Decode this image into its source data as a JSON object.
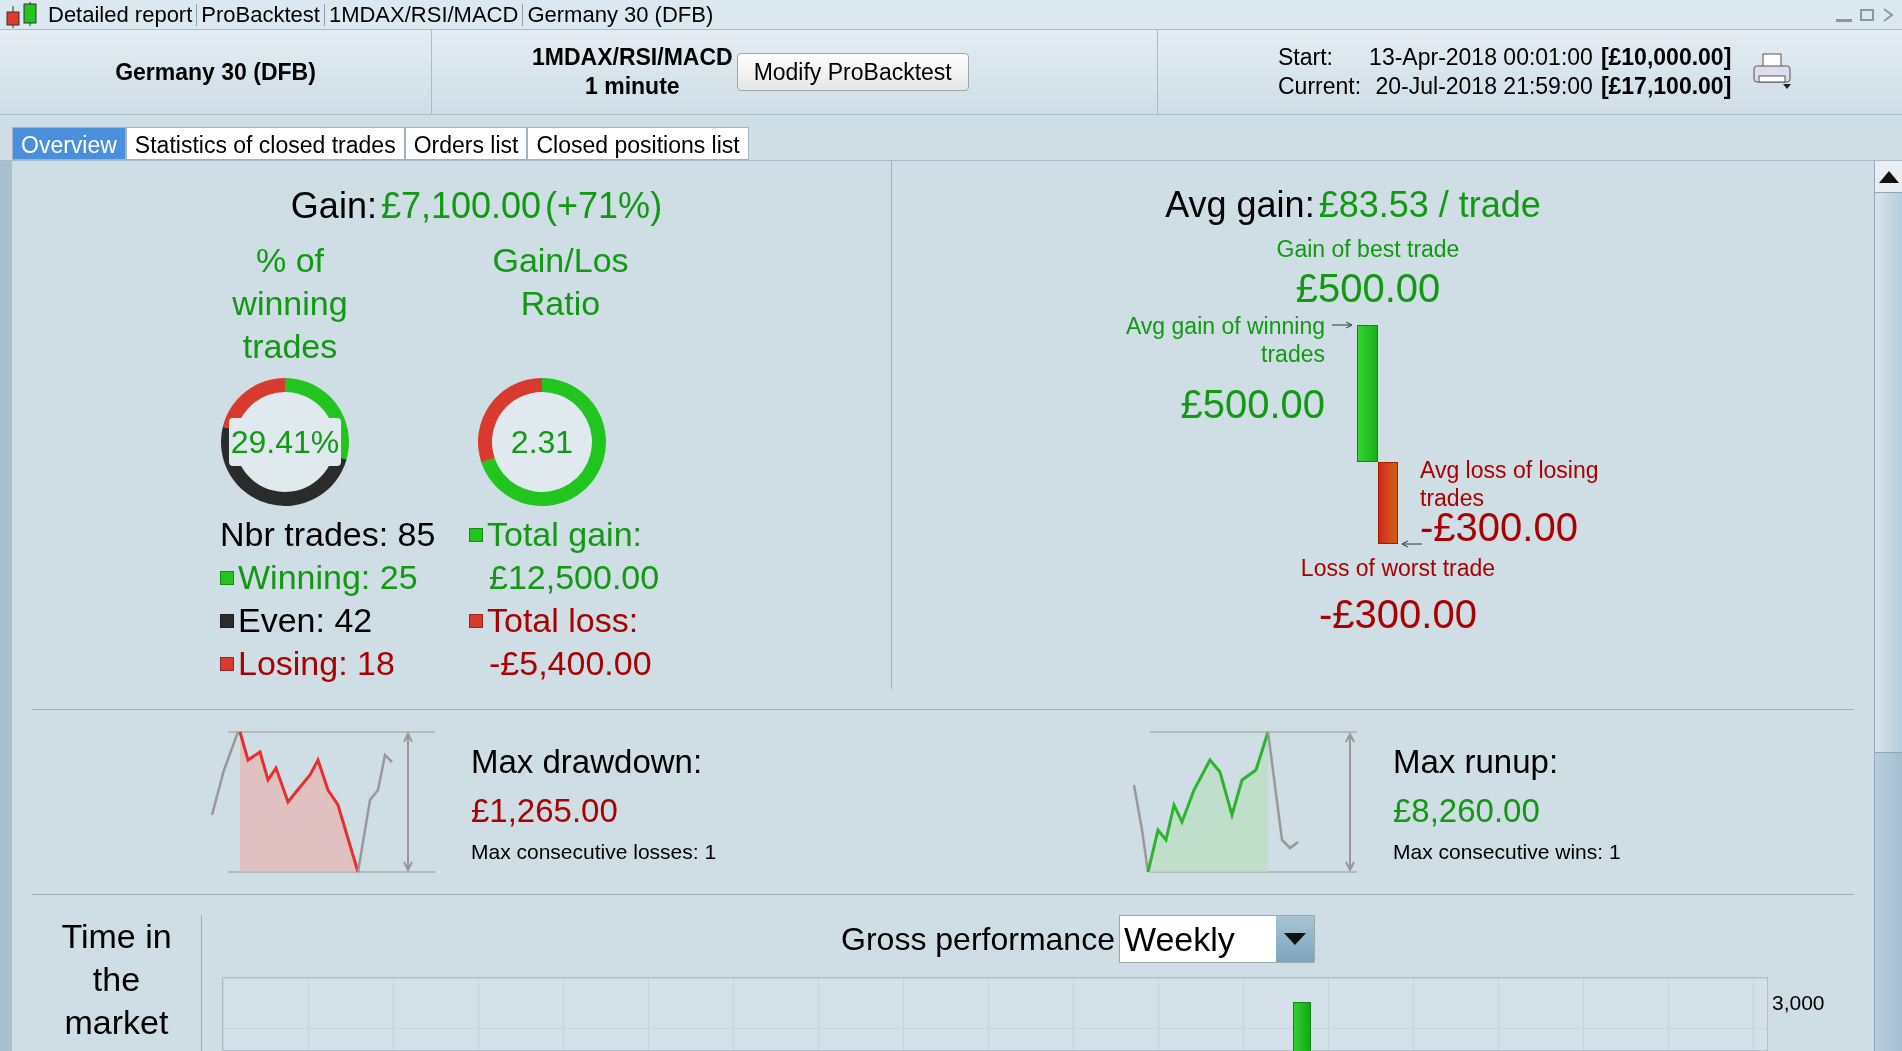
{
  "title_bar": {
    "items": [
      "Detailed report",
      "ProBacktest",
      "1MDAX/RSI/MACD",
      "Germany 30 (DFB)"
    ]
  },
  "header": {
    "instrument": "Germany 30 (DFB)",
    "system": "1MDAX/RSI/MACD",
    "timeframe": "1 minute",
    "modify_button": "Modify ProBacktest",
    "start_label": "Start:",
    "start_date": "13-Apr-2018 00:01:00",
    "start_capital": "[£10,000.00]",
    "current_label": "Current:",
    "current_date": "20-Jul-2018 21:59:00",
    "current_capital": "[£17,100.00]"
  },
  "tabs": [
    {
      "label": "Overview",
      "selected": true
    },
    {
      "label": "Statistics of closed trades",
      "selected": false
    },
    {
      "label": "Orders list",
      "selected": false
    },
    {
      "label": "Closed positions list",
      "selected": false
    }
  ],
  "gain": {
    "label": "Gain:",
    "value": "£7,100.00",
    "percent": "(+71%)"
  },
  "winning_donut": {
    "heading": "% of winning trades",
    "value": "29.41%",
    "chart_data": {
      "type": "donut",
      "values": [
        29.41,
        49.41,
        21.18
      ]
    }
  },
  "ratio_donut": {
    "heading": "Gain/Los Ratio",
    "value": "2.31",
    "chart_data": {
      "type": "donut",
      "values": [
        69.83,
        30.17
      ]
    }
  },
  "trades": {
    "total": "Nbr trades: 85",
    "items": [
      {
        "kind": "gain",
        "label": "Winning: 25",
        "color": "#22c41e"
      },
      {
        "kind": "neutral",
        "label": "Even: 42",
        "color": "#2b2b2b"
      },
      {
        "kind": "loss",
        "label": "Losing: 18",
        "color": "#d83a2e"
      }
    ]
  },
  "totals": [
    {
      "kind": "gain",
      "label": "Total gain:",
      "value": "£12,500.00",
      "color": "#22c41e"
    },
    {
      "kind": "loss",
      "label": "Total loss:",
      "value": "-£5,400.00",
      "color": "#d83a2e"
    }
  ],
  "avg_gain": {
    "label": "Avg gain:",
    "value": "£83.53 / trade"
  },
  "waterfall": {
    "best_label": "Gain of best trade",
    "best_value": "£500.00",
    "avg_win_label": "Avg gain of winning trades",
    "avg_win_value": "£500.00",
    "avg_loss_label": "Avg loss of losing trades",
    "avg_loss_value": "-£300.00",
    "worst_label": "Loss of worst trade",
    "worst_value": "-£300.00"
  },
  "drawdown": {
    "label": "Max drawdown:",
    "value": "£1,265.00",
    "consecutive": "Max consecutive losses: 1"
  },
  "runup": {
    "label": "Max runup:",
    "value": "£8,260.00",
    "consecutive": "Max consecutive wins: 1"
  },
  "time_in_market": {
    "label": "Time in the market"
  },
  "gross_performance": {
    "label": "Gross performance",
    "period": "Weekly",
    "tick": "3,000"
  }
}
